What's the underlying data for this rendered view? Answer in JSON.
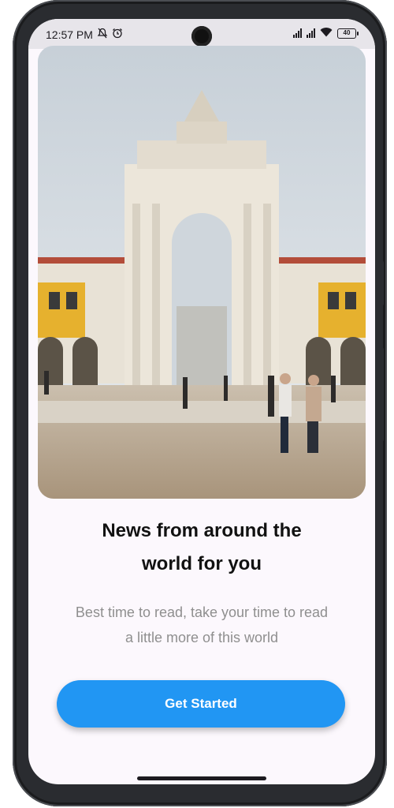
{
  "status_bar": {
    "time": "12:57 PM",
    "battery": "40",
    "icons": [
      "notifications-off-icon",
      "alarm-icon",
      "signal-icon",
      "signal-icon",
      "wifi-icon",
      "battery-icon"
    ]
  },
  "hero": {
    "icon": "city-arch-photo"
  },
  "onboarding": {
    "title_line1": "News from around the",
    "title_line2": "world for you",
    "subtitle_line1": "Best time to read, take your time to read",
    "subtitle_line2": "a little more of this world",
    "cta_label": "Get Started"
  },
  "colors": {
    "accent": "#2196f3",
    "background": "#fcf8fd",
    "subtitle": "#8f8f8f",
    "title": "#111111"
  }
}
